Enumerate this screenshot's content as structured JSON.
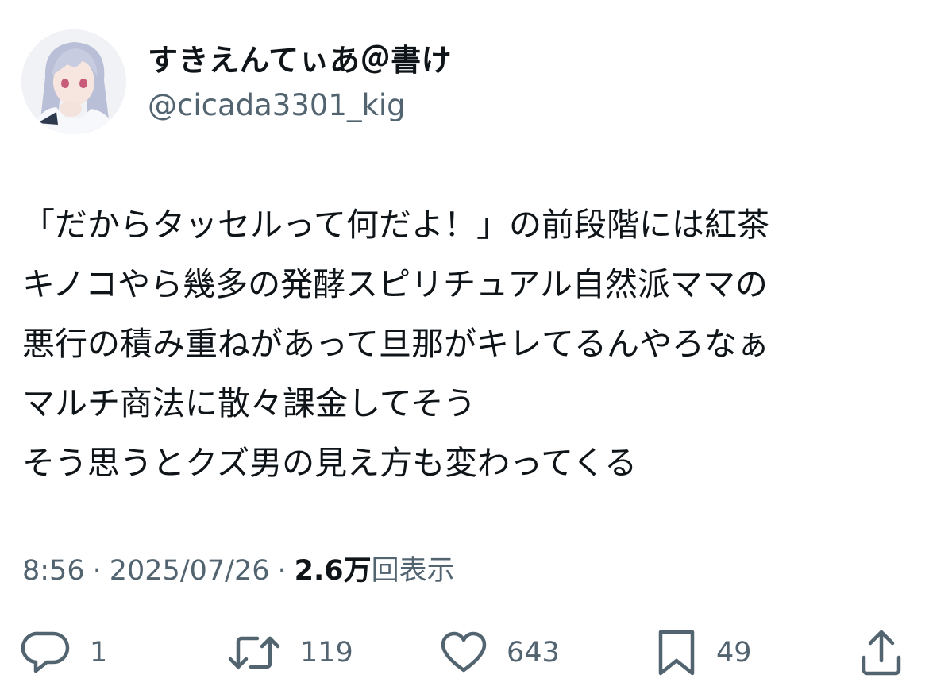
{
  "user": {
    "display_name": "すきえんてぃあ＠書け",
    "handle": "@cicada3301_kig"
  },
  "tweet": {
    "lines": [
      "「だからタッセルって何だよ！」の前段階には紅茶",
      "キノコやら幾多の発酵スピリチュアル自然派ママの",
      "悪行の積み重ねがあって旦那がキレてるんやろなぁ",
      "マルチ商法に散々課金してそう",
      "そう思うとクズ男の見え方も変わってくる"
    ]
  },
  "meta": {
    "time": "8:56",
    "separator": "·",
    "date": "2025/07/26",
    "views_count": "2.6万",
    "views_label": "回表示"
  },
  "actions": {
    "reply": {
      "icon": "reply-icon",
      "count": "1"
    },
    "retweet": {
      "icon": "retweet-icon",
      "count": "119"
    },
    "like": {
      "icon": "heart-icon",
      "count": "643"
    },
    "bookmark": {
      "icon": "bookmark-icon",
      "count": "49"
    },
    "share": {
      "icon": "share-icon"
    }
  },
  "colors": {
    "text": "#0f1419",
    "secondary": "#536471",
    "background": "#ffffff"
  }
}
